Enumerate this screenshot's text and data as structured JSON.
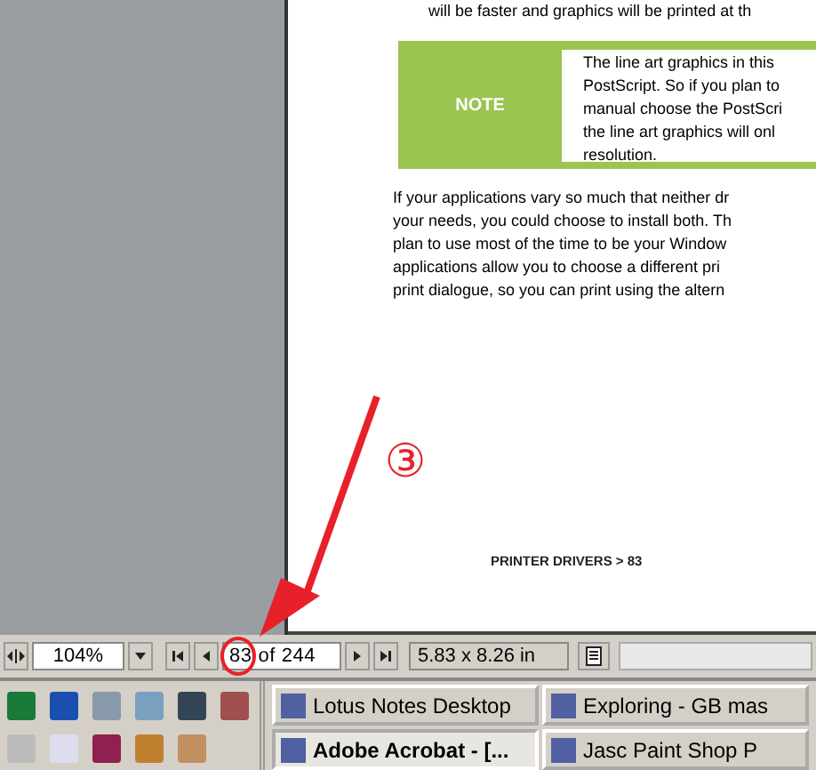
{
  "document": {
    "top_line": "will be faster and graphics will be printed at th",
    "note": {
      "label": "NOTE",
      "lines": [
        "The line art graphics in this",
        "PostScript. So if you plan to",
        "manual choose the PostScri",
        "the line art graphics will onl",
        "resolution."
      ]
    },
    "paragraph": [
      "If your applications vary so much that neither dr",
      "your needs, you could choose to install both. Th",
      "plan to use most of the time to be your Window",
      "applications allow you to choose a different pri",
      "print dialogue, so you can print using the altern"
    ],
    "footer": "PRINTER DRIVERS > 83"
  },
  "annotation": {
    "number": "③"
  },
  "status_bar": {
    "zoom": "104%",
    "page": "83 of 244",
    "page_size": "5.83 x 8.26 in"
  },
  "taskbar": {
    "tasks": [
      {
        "label": "Lotus Notes Desktop",
        "selected": false
      },
      {
        "label": "Exploring - GB mas",
        "selected": false
      },
      {
        "label": "Adobe Acrobat - [...",
        "selected": true
      },
      {
        "label": "Jasc Paint Shop P",
        "selected": false
      }
    ]
  }
}
